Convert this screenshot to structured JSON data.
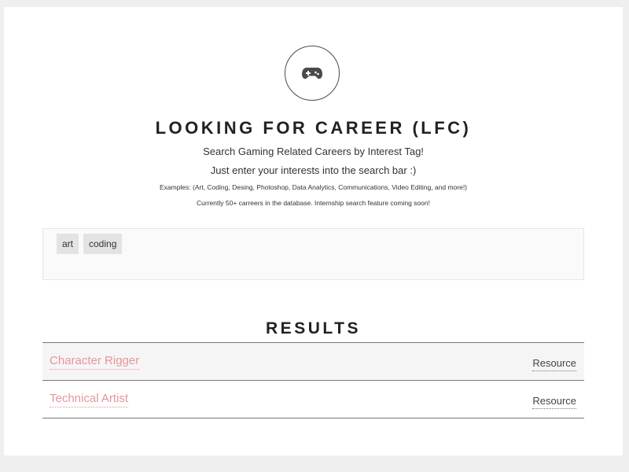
{
  "header": {
    "logo_icon": "gamepad-icon",
    "title": "LOOKING FOR CAREER (LFC)",
    "subtitle_1": "Search Gaming Related Careers by Interest Tag!",
    "subtitle_2": "Just enter your interests into the search bar :)",
    "examples": "Examples: (Art, Coding, Desing, Photoshop, Data Analytics, Communications, Video Editing, and more!)",
    "db_note": "Currently 50+ carreers in the database. Internship search feature coming soon!"
  },
  "search": {
    "tags": [
      "art",
      "coding"
    ]
  },
  "results": {
    "heading": "RESULTS",
    "rows": [
      {
        "career": "Character Rigger",
        "resource": "Resource"
      },
      {
        "career": "Technical Artist",
        "resource": "Resource"
      }
    ]
  },
  "colors": {
    "link": "#e8949c",
    "background": "#efefef",
    "card": "#ffffff"
  }
}
